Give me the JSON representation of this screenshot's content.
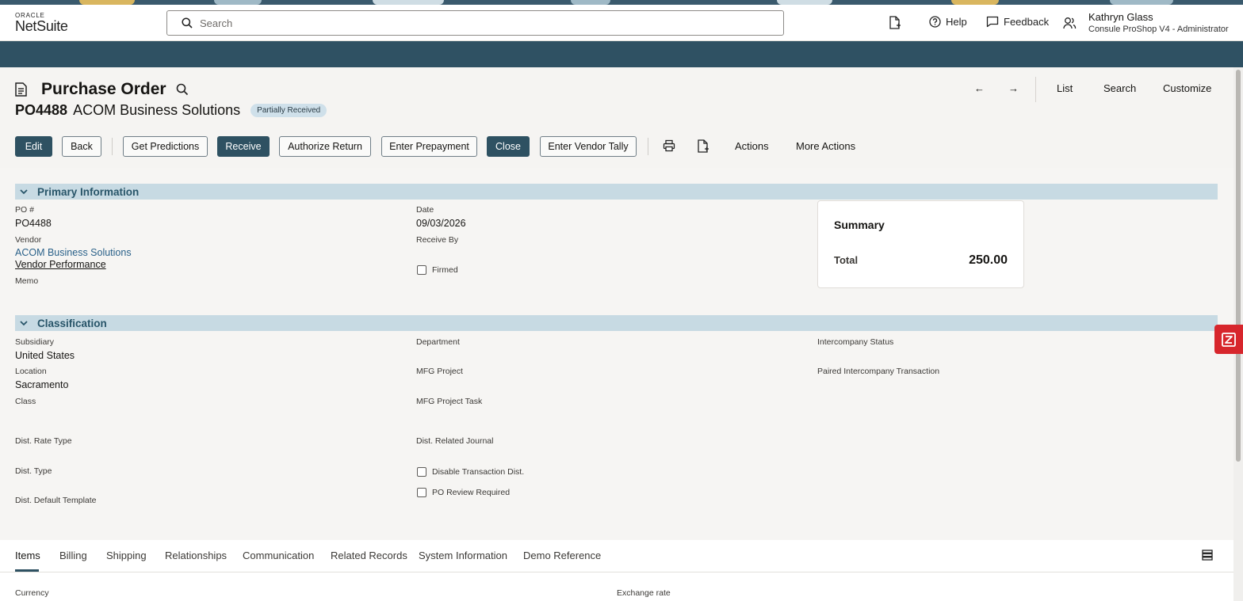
{
  "header": {
    "logo_top": "ORACLE",
    "logo_bottom": "NetSuite",
    "search_placeholder": "Search",
    "help_label": "Help",
    "feedback_label": "Feedback",
    "user_name": "Kathryn Glass",
    "user_role": "Consule ProShop V4 - Administrator"
  },
  "record": {
    "title": "Purchase Order",
    "number": "PO4488",
    "vendor_name": "ACOM Business Solutions",
    "status": "Partially Received"
  },
  "nav": {
    "prev": "←",
    "next": "→",
    "list": "List",
    "search": "Search",
    "customize": "Customize"
  },
  "toolbar": {
    "edit": "Edit",
    "back": "Back",
    "get_predictions": "Get Predictions",
    "receive": "Receive",
    "authorize_return": "Authorize Return",
    "enter_prepayment": "Enter Prepayment",
    "close": "Close",
    "enter_vendor_tally": "Enter Vendor Tally",
    "actions": "Actions",
    "more_actions": "More Actions"
  },
  "primary": {
    "heading": "Primary Information",
    "po_label": "PO #",
    "po_value": "PO4488",
    "vendor_label": "Vendor",
    "vendor_value": "ACOM Business Solutions",
    "vendor_performance": "Vendor Performance",
    "memo_label": "Memo",
    "date_label": "Date",
    "date_value": "09/03/2026",
    "receive_by_label": "Receive By",
    "firmed_label": "Firmed"
  },
  "summary": {
    "title": "Summary",
    "total_label": "Total",
    "total_value": "250.00"
  },
  "classification": {
    "heading": "Classification",
    "subsidiary_label": "Subsidiary",
    "subsidiary_value": "United States",
    "location_label": "Location",
    "location_value": "Sacramento",
    "class_label": "Class",
    "dist_rate_type_label": "Dist. Rate Type",
    "dist_type_label": "Dist. Type",
    "dist_default_template_label": "Dist. Default Template",
    "department_label": "Department",
    "mfg_project_label": "MFG Project",
    "mfg_project_task_label": "MFG Project Task",
    "dist_related_journal_label": "Dist. Related Journal",
    "disable_transaction_dist_label": "Disable Transaction Dist.",
    "po_review_required_label": "PO Review Required",
    "intercompany_status_label": "Intercompany Status",
    "paired_intercompany_label": "Paired Intercompany Transaction"
  },
  "tabs": [
    {
      "label": "Items"
    },
    {
      "label": "Billing"
    },
    {
      "label": "Shipping"
    },
    {
      "label": "Relationships"
    },
    {
      "label": "Communication"
    },
    {
      "label": "Related Records"
    },
    {
      "label": "System Information"
    },
    {
      "label": "Demo Reference"
    }
  ],
  "lower": {
    "currency_label": "Currency",
    "exchange_rate_label": "Exchange rate"
  },
  "colors": {
    "brand_navy": "#2f5163",
    "section_blue": "#c7dae3",
    "link_blue": "#2a6189"
  }
}
